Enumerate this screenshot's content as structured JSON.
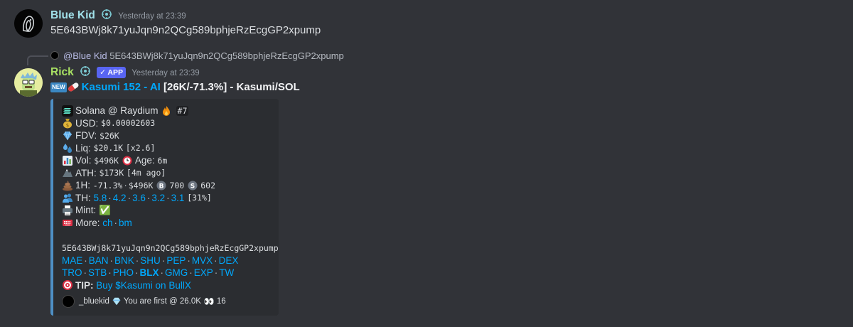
{
  "message1": {
    "author": "Blue Kid",
    "timestamp": "Yesterday at 23:39",
    "content": "5E643BWj8k71yuJqn9n2QCg589bphjeRzEcgGP2xpump"
  },
  "reply": {
    "mention": "@Blue Kid",
    "content": "5E643BWj8k71yuJqn9n2QCg589bphjeRzEcgGP2xpump"
  },
  "message2": {
    "author": "Rick",
    "app_badge": "✓ APP",
    "timestamp": "Yesterday at 23:39",
    "title_link": "Kasumi 152 - AI",
    "title_rest": " [26K/-71.3%] - Kasumi/SOL",
    "new_badge": "NEW"
  },
  "embed": {
    "chain_line": "Solana @ Raydium",
    "rank": "#7",
    "usd_label": "USD:",
    "usd_value": "$0.00002603",
    "fdv_label": "FDV:",
    "fdv_value": "$26K",
    "liq_label": "Liq:",
    "liq_value": "$20.1K",
    "liq_mult": "[x2.6]",
    "vol_label": "Vol:",
    "vol_value": "$496K",
    "age_label": "Age:",
    "age_value": "6m",
    "ath_label": "ATH:",
    "ath_value": "$173K",
    "ath_ago": "[4m ago]",
    "h1_label": "1H:",
    "h1_change": "-71.3%",
    "h1_dot": "·",
    "h1_vol": "$496K",
    "h1_buys": "700",
    "h1_sells": "602",
    "th_label": "TH:",
    "th_values": [
      "5.8",
      "4.2",
      "3.6",
      "3.2",
      "3.1"
    ],
    "th_pct": "[31%]",
    "mint_label": "Mint:",
    "mint_icon": "✅",
    "more_label": "More:",
    "more_links": [
      "ch",
      "bm"
    ],
    "address": "5E643BWj8k71yuJqn9n2QCg589bphjeRzEcgGP2xpump",
    "links_row1": [
      "MAE",
      "BAN",
      "BNK",
      "SHU",
      "PEP",
      "MVX",
      "DEX"
    ],
    "links_row2": [
      "TRO",
      "STB",
      "PHO",
      "BLX",
      "GMG",
      "EXP",
      "TW"
    ],
    "tip_label": "TIP:",
    "tip_link": "Buy $Kasumi on BullX",
    "footer_user": "_bluekid",
    "footer_text": "You are first @ 26.0K",
    "footer_count": "16"
  },
  "colors": {
    "background": "#313338",
    "embed_bg": "#2b2d31",
    "embed_accent": "#4e8fc4",
    "link": "#00a8fc",
    "bluekid_name": "#a1e1ea",
    "rick_name": "#a8e063",
    "app_badge": "#5865f2"
  }
}
